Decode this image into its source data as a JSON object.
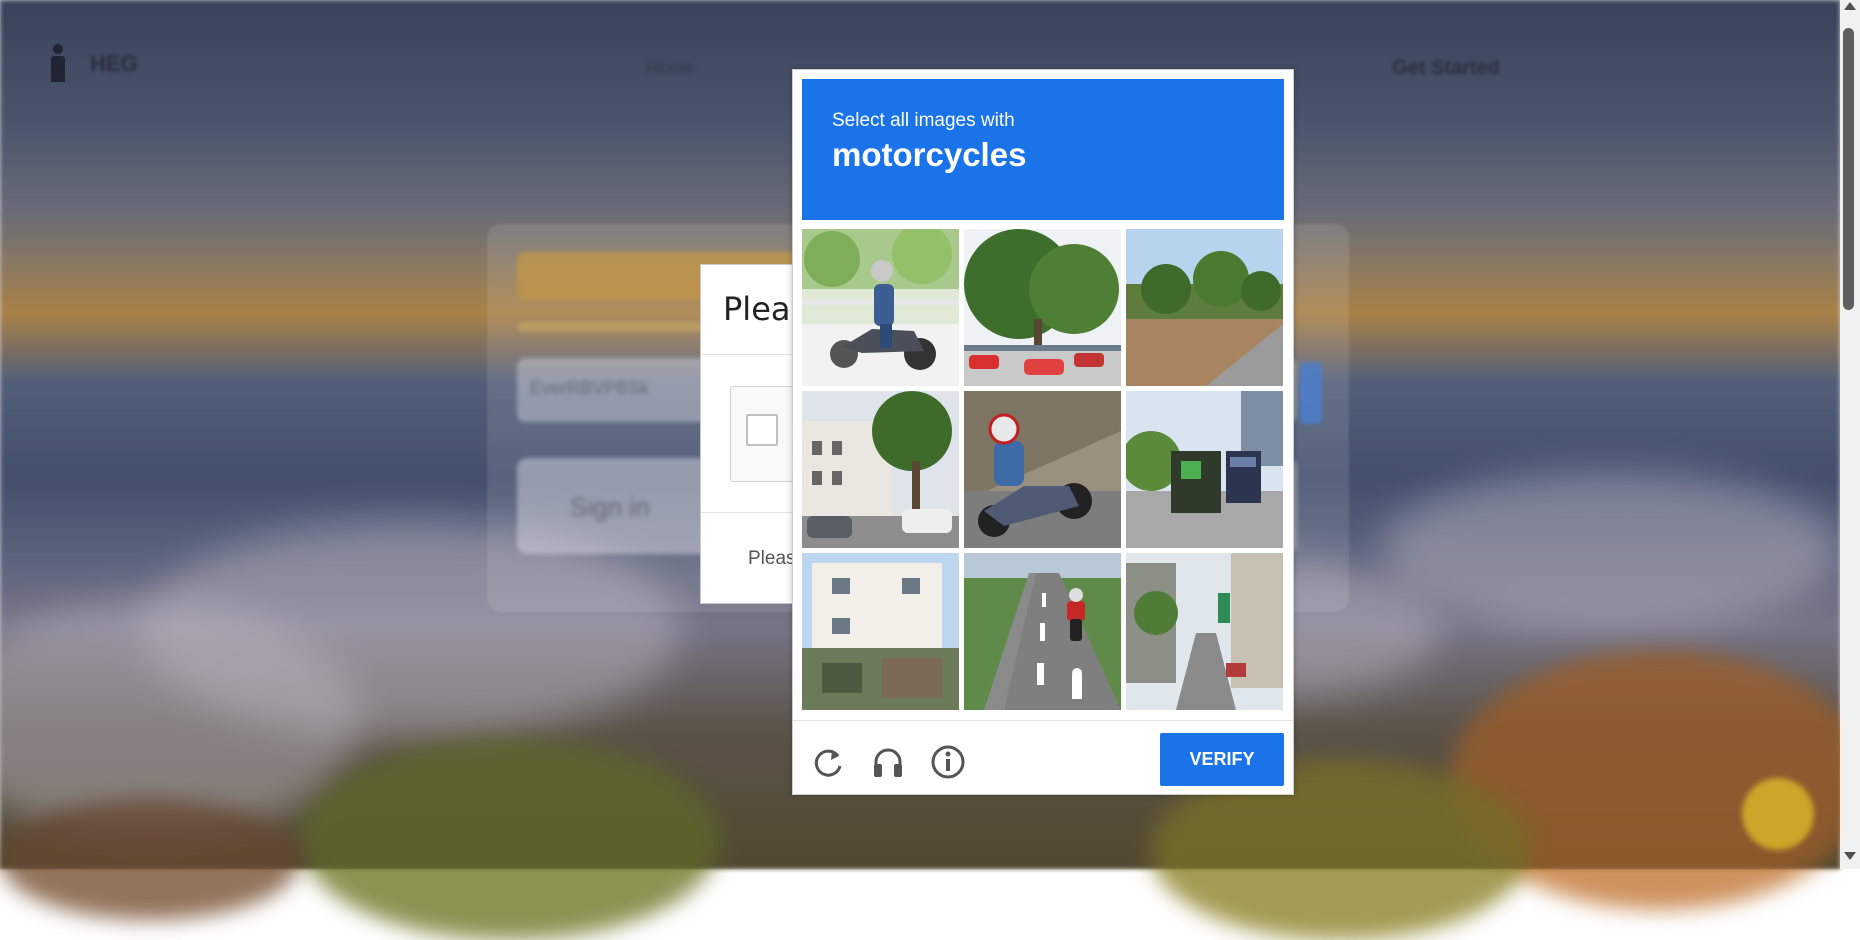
{
  "background_page": {
    "logo_text": "HEG",
    "nav": [
      "Home",
      "",
      "",
      ""
    ],
    "get_started": "Get Started",
    "input_placeholder": "EverRBVPBSk",
    "button_text": "Sign in"
  },
  "anchor": {
    "title": "Pleas",
    "footer": "Pleas"
  },
  "challenge": {
    "instruction": "Select all images with",
    "target": "motorcycles",
    "tiles": [
      {
        "id": 1,
        "content": "motorcycle rider on scooter"
      },
      {
        "id": 2,
        "content": "trees and parked cars"
      },
      {
        "id": 3,
        "content": "road with trees"
      },
      {
        "id": 4,
        "content": "building with trees and cars"
      },
      {
        "id": 5,
        "content": "motorcycle on road"
      },
      {
        "id": 6,
        "content": "trucks on street"
      },
      {
        "id": 7,
        "content": "house"
      },
      {
        "id": 8,
        "content": "motorcycle on highway"
      },
      {
        "id": 9,
        "content": "narrow street"
      }
    ],
    "footer_icons": [
      "reload-icon",
      "audio-icon",
      "info-icon"
    ],
    "verify_label": "VERIFY",
    "accent_color": "#1a73e8"
  }
}
